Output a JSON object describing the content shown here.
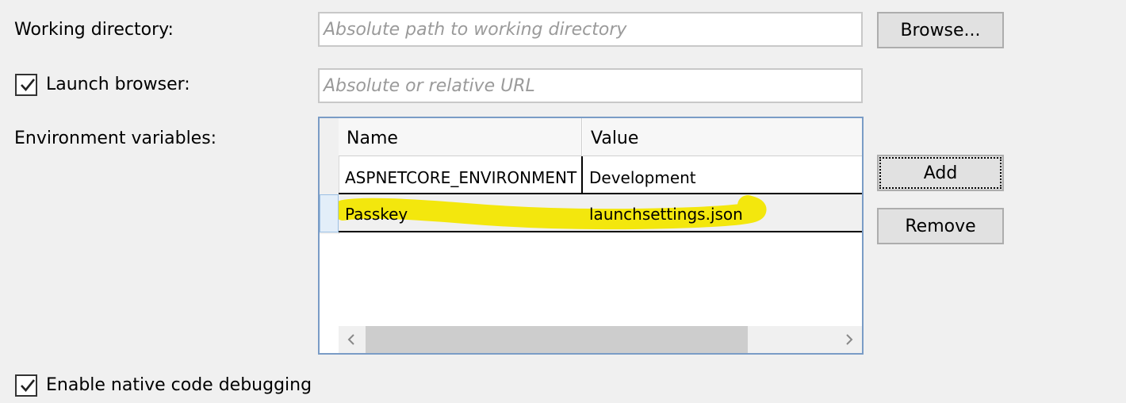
{
  "working_directory": {
    "label": "Working directory:",
    "placeholder": "Absolute path to working directory",
    "browse_label": "Browse..."
  },
  "launch_browser": {
    "label": "Launch browser:",
    "checked": true,
    "placeholder": "Absolute or relative URL"
  },
  "environment_variables": {
    "label": "Environment variables:",
    "columns": [
      "Name",
      "Value"
    ],
    "rows": [
      {
        "name": "ASPNETCORE_ENVIRONMENT",
        "value": "Development"
      },
      {
        "name": "Passkey",
        "value": "launchsettings.json"
      }
    ],
    "add_label": "Add",
    "remove_label": "Remove"
  },
  "native_debugging": {
    "label": "Enable native code debugging",
    "checked": true
  },
  "colors": {
    "highlight": "#f2e600",
    "grid_border": "#7a9cc6",
    "button_bg": "#e1e1e1"
  },
  "icons": {
    "scroll_left": "chevron-left-icon",
    "scroll_right": "chevron-right-icon",
    "checkbox": "checkmark-icon"
  }
}
